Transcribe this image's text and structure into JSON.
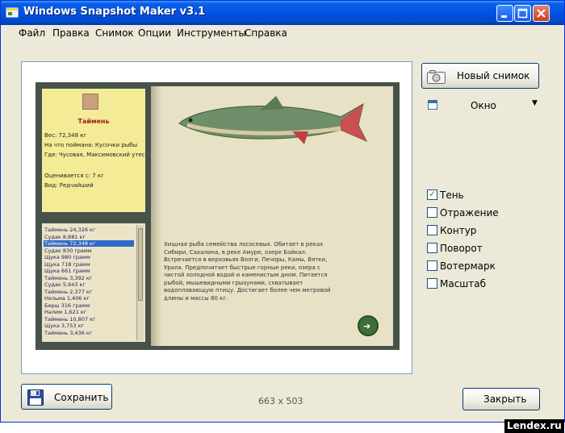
{
  "window": {
    "title": "Windows Snapshot Maker v3.1"
  },
  "menu": {
    "items": [
      "Файл",
      "Правка",
      "Снимок",
      "Опции",
      "Инструменты",
      "Справка"
    ]
  },
  "preview": {
    "note": {
      "title": "Таймень",
      "lines": [
        "Вес: 72,348 кг",
        "На что поймана: Кусочки рыбы",
        "Где: Чусовая, Максимовский утес",
        "Оценивается с: 7 кг",
        "Вид: Редчайший"
      ]
    },
    "list": {
      "items": [
        "Таймень 24,326 кг",
        "Судак 8,881 кг",
        "Таймень 72,348 кг",
        "Судак 830 грамм",
        "Щука 980 грамм",
        "Щука 718 грамм",
        "Щука 661 грамм",
        "Таймень 3,392 кг",
        "Судак 5,943 кг",
        "Таймень 2,377 кг",
        "Нельма 1,406 кг",
        "Берш 316 грамм",
        "Налим 1,621 кг",
        "Таймень 10,807 кг",
        "Щука 3,753 кг",
        "Таймень 3,436 кг"
      ],
      "selected_index": 2
    },
    "description": "Хищная рыба семейства лососевых. Обитает в реках Сибири, Сахалина, в реке Амуре, озере Байкал. Встречается в верховьях Волги, Печоры, Камы, Вятки, Урала. Предпочитает быстрые горные реки, озера с чистой холодной водой и каменистым дном. Питается рыбой, мышевидными грызунами, схватывает водоплавающую птицу. Достигает более чем метровой длины и массы 80 кг."
  },
  "controls": {
    "new_snapshot_label": "Новый снимок",
    "mode_value": "Окно",
    "options": [
      {
        "label": "Тень",
        "checked": true
      },
      {
        "label": "Отражение",
        "checked": false
      },
      {
        "label": "Контур",
        "checked": false
      },
      {
        "label": "Поворот",
        "checked": false
      },
      {
        "label": "Вотермарк",
        "checked": false
      },
      {
        "label": "Масштаб",
        "checked": false
      }
    ]
  },
  "footer": {
    "save_label": "Сохранить",
    "resolution": "663 x 503",
    "close_label": "Закрыть"
  },
  "watermark": "Lendex.ru",
  "colors": {
    "titlebar": "#0053e1",
    "selection": "#3169c6",
    "window_bg": "#ece9d8"
  }
}
